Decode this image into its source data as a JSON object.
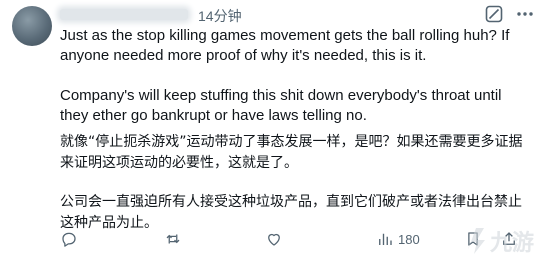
{
  "tweet": {
    "time": "14分钟",
    "paragraphs": {
      "en1": "Just as the stop killing games movement gets the ball rolling huh? If anyone needed more proof of why it's needed, this is it.",
      "en2": "Company's will keep stuffing this shit down everybody's throat until they ether go bankrupt or have laws telling no.",
      "zh1": "就像“停止扼杀游戏”运动带动了事态发展一样，是吧？如果还需要更多证据来证明这项运动的必要性，这就是了。",
      "zh2": "公司会一直强迫所有人接受这种垃圾产品，直到它们破产或者法律出台禁止这种产品为止。"
    },
    "views": "180"
  },
  "watermark": {
    "brand": "九游"
  },
  "icons": {
    "avatar": "avatar",
    "grok": "grok-slash-icon",
    "more": "more-icon",
    "reply": "reply-icon",
    "retweet": "retweet-icon",
    "like": "like-icon",
    "views": "views-icon",
    "bookmark": "bookmark-icon",
    "share": "share-icon"
  },
  "colors": {
    "text": "#0f1419",
    "secondary": "#536471"
  }
}
